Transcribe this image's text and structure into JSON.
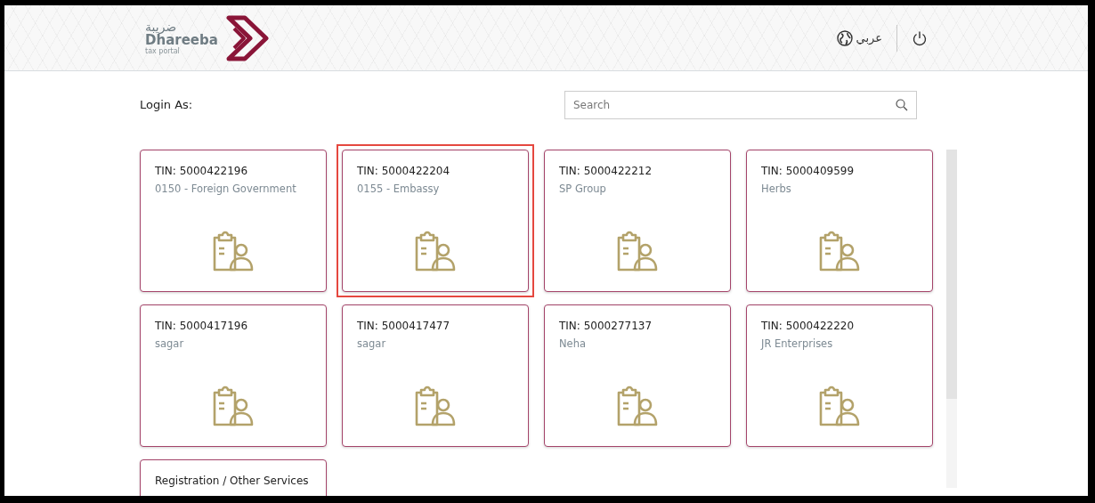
{
  "header": {
    "logo": {
      "arabic": "ضريبة",
      "name": "Dhareeba",
      "tagline": "tax portal"
    },
    "language": "عربي"
  },
  "login_label": "Login As:",
  "search": {
    "placeholder": "Search"
  },
  "accounts": [
    {
      "tin": "TIN: 5000422196",
      "name": "0150 - Foreign Government",
      "highlighted": false
    },
    {
      "tin": "TIN: 5000422204",
      "name": "0155 - Embassy",
      "highlighted": true
    },
    {
      "tin": "TIN: 5000422212",
      "name": "SP Group",
      "highlighted": false
    },
    {
      "tin": "TIN: 5000409599",
      "name": "Herbs",
      "highlighted": false
    },
    {
      "tin": "TIN: 5000417196",
      "name": "sagar",
      "highlighted": false
    },
    {
      "tin": "TIN: 5000417477",
      "name": "sagar",
      "highlighted": false
    },
    {
      "tin": "TIN: 5000277137",
      "name": "Neha",
      "highlighted": false
    },
    {
      "tin": "TIN: 5000422220",
      "name": "JR Enterprises",
      "highlighted": false
    }
  ],
  "other_services": {
    "title": "Registration / Other Services"
  }
}
